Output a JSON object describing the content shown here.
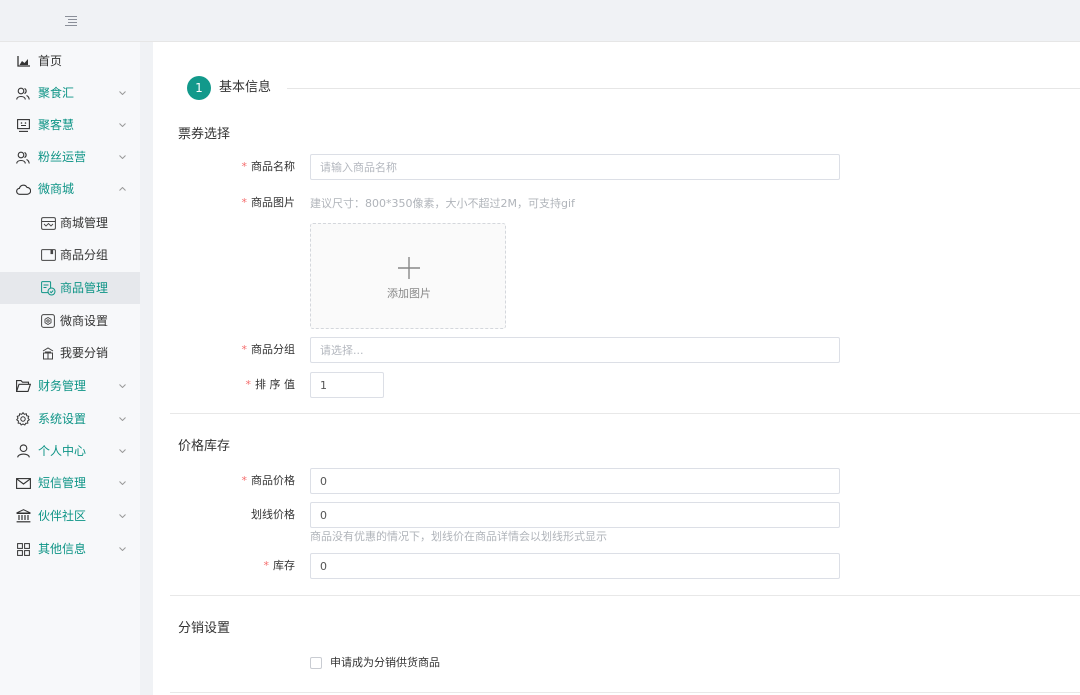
{
  "header": {
    "menu_toggle_icon": "hamburger-icon"
  },
  "sidebar": {
    "items": [
      {
        "label": "首页",
        "icon": "chart-icon",
        "has_arrow": false
      },
      {
        "label": "聚食汇",
        "icon": "users-icon",
        "has_arrow": true
      },
      {
        "label": "聚客慧",
        "icon": "monitor-icon",
        "has_arrow": true
      },
      {
        "label": "粉丝运营",
        "icon": "users-icon",
        "has_arrow": true
      },
      {
        "label": "微商城",
        "icon": "cloud-icon",
        "has_arrow": true,
        "expanded": true
      },
      {
        "label": "财务管理",
        "icon": "folder-icon",
        "has_arrow": true
      },
      {
        "label": "系统设置",
        "icon": "gear-icon",
        "has_arrow": true
      },
      {
        "label": "个人中心",
        "icon": "user-icon",
        "has_arrow": true
      },
      {
        "label": "短信管理",
        "icon": "mail-icon",
        "has_arrow": true
      },
      {
        "label": "伙伴社区",
        "icon": "bank-icon",
        "has_arrow": true
      },
      {
        "label": "其他信息",
        "icon": "grid-icon",
        "has_arrow": true
      }
    ],
    "subitems": [
      {
        "label": "商城管理",
        "icon": "store-icon"
      },
      {
        "label": "商品分组",
        "icon": "group-icon"
      },
      {
        "label": "商品管理",
        "icon": "goods-icon",
        "active": true
      },
      {
        "label": "微商设置",
        "icon": "settings-icon"
      },
      {
        "label": "我要分销",
        "icon": "distribute-icon"
      }
    ]
  },
  "main": {
    "step": {
      "number": "1",
      "title": "基本信息"
    },
    "section1": {
      "title": "票券选择",
      "name_label": "商品名称",
      "name_placeholder": "请输入商品名称",
      "image_label": "商品图片",
      "image_hint": "建议尺寸：800*350像素，大小不超过2M，可支持gif",
      "upload_text": "添加图片",
      "group_label": "商品分组",
      "group_placeholder": "请选择...",
      "sort_label": "排 序 值",
      "sort_value": "1"
    },
    "section2": {
      "title": "价格库存",
      "price_label": "商品价格",
      "price_value": "0",
      "strike_label": "划线价格",
      "strike_value": "0",
      "strike_hint": "商品没有优惠的情况下，划线价在商品详情会以划线形式显示",
      "stock_label": "库存",
      "stock_value": "0"
    },
    "section3": {
      "title": "分销设置",
      "checkbox_label": "申请成为分销供货商品",
      "checkbox_checked": false
    }
  },
  "colors": {
    "accent": "#0e9486",
    "step_circle": "#12998b",
    "required": "#f56c6c"
  }
}
